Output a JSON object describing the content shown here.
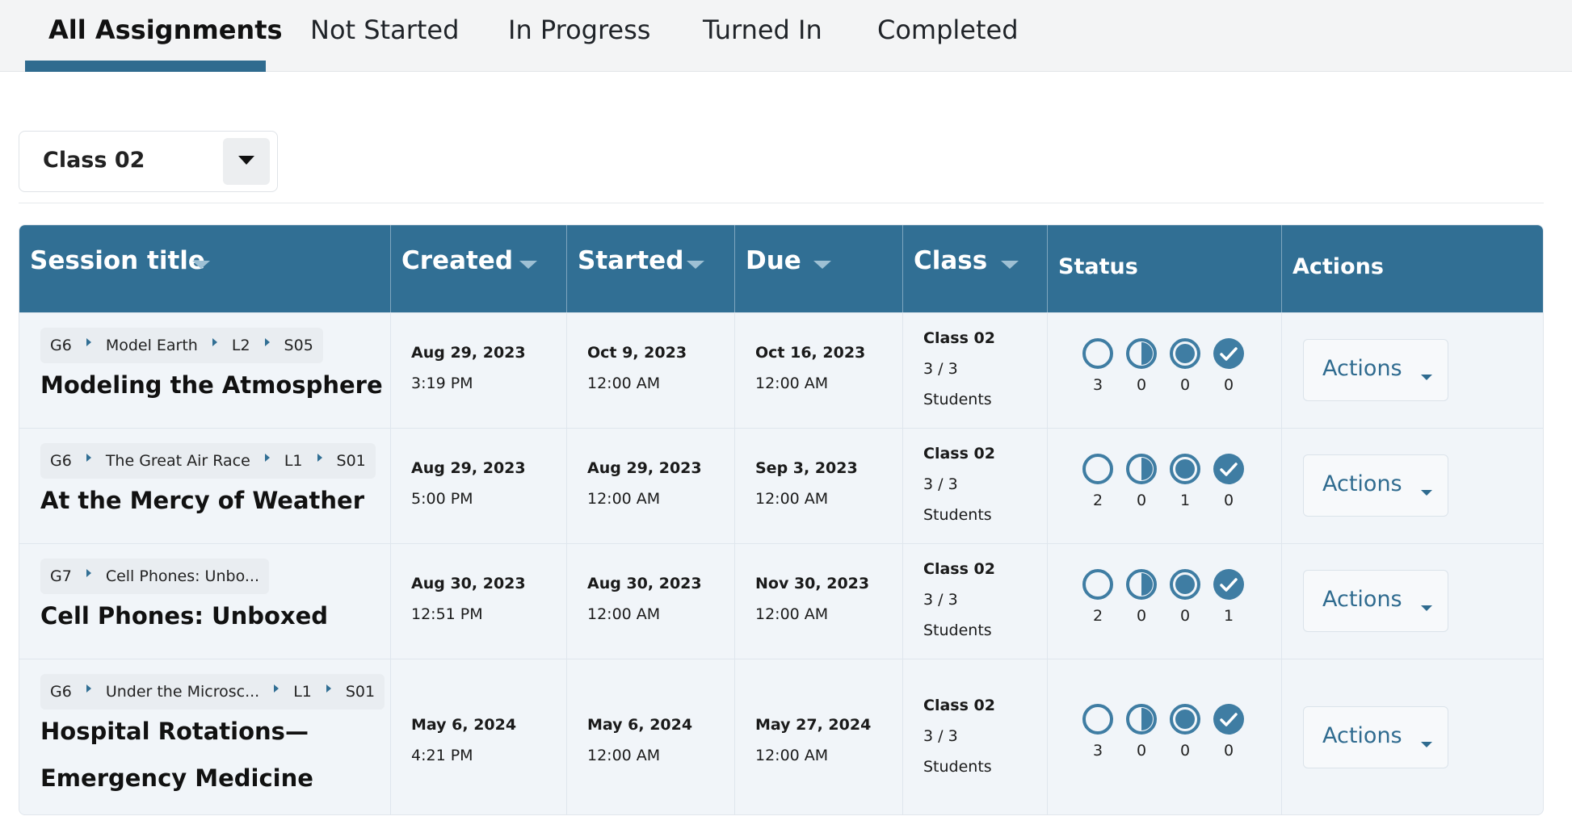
{
  "tabs": [
    "All Assignments",
    "Not Started",
    "In Progress",
    "Turned In",
    "Completed"
  ],
  "filter": {
    "selected": "Class 02"
  },
  "table": {
    "headers": {
      "session_title": "Session title",
      "created": "Created",
      "started": "Started",
      "due": "Due",
      "class": "Class",
      "status": "Status",
      "actions": "Actions"
    },
    "rows": [
      {
        "crumbs": [
          "G6",
          "Model Earth",
          "L2",
          "S05"
        ],
        "title_lines": [
          "Modeling the Atmosphere"
        ],
        "created_date": "Aug 29, 2023",
        "created_time": "3:19 PM",
        "started_date": "Oct 9, 2023",
        "started_time": "12:00 AM",
        "due_date": "Oct 16, 2023",
        "due_time": "12:00 AM",
        "class_name": "Class 02",
        "class_count": "3 / 3",
        "class_unit": "Students",
        "status_counts": [
          "3",
          "0",
          "0",
          "0"
        ],
        "action_label": "Actions"
      },
      {
        "crumbs": [
          "G6",
          "The Great Air Race",
          "L1",
          "S01"
        ],
        "title_lines": [
          "At the Mercy of Weather"
        ],
        "created_date": "Aug 29, 2023",
        "created_time": "5:00 PM",
        "started_date": "Aug 29, 2023",
        "started_time": "12:00 AM",
        "due_date": "Sep 3, 2023",
        "due_time": "12:00 AM",
        "class_name": "Class 02",
        "class_count": "3 / 3",
        "class_unit": "Students",
        "status_counts": [
          "2",
          "0",
          "1",
          "0"
        ],
        "action_label": "Actions"
      },
      {
        "crumbs": [
          "G7",
          "Cell Phones: Unbo..."
        ],
        "title_lines": [
          "Cell Phones: Unboxed"
        ],
        "created_date": "Aug 30, 2023",
        "created_time": "12:51 PM",
        "started_date": "Aug 30, 2023",
        "started_time": "12:00 AM",
        "due_date": "Nov 30, 2023",
        "due_time": "12:00 AM",
        "class_name": "Class 02",
        "class_count": "3 / 3",
        "class_unit": "Students",
        "status_counts": [
          "2",
          "0",
          "0",
          "1"
        ],
        "action_label": "Actions"
      },
      {
        "crumbs": [
          "G6",
          "Under the Microsc...",
          "L1",
          "S01"
        ],
        "title_lines": [
          "Hospital Rotations—",
          "Emergency Medicine"
        ],
        "created_date": "May 6, 2024",
        "created_time": "4:21 PM",
        "started_date": "May 6, 2024",
        "started_time": "12:00 AM",
        "due_date": "May 27, 2024",
        "due_time": "12:00 AM",
        "class_name": "Class 02",
        "class_count": "3 / 3",
        "class_unit": "Students",
        "status_counts": [
          "3",
          "0",
          "0",
          "0"
        ],
        "action_label": "Actions"
      }
    ],
    "status_icons": [
      "not-started-circle-icon",
      "in-progress-half-circle-icon",
      "turned-in-filled-circle-icon",
      "completed-check-circle-icon"
    ]
  },
  "colors": {
    "accent": "#316f94",
    "header_bg": "#316f94",
    "row_bg": "#f1f5f9",
    "tab_underline": "#2f6b8f"
  }
}
